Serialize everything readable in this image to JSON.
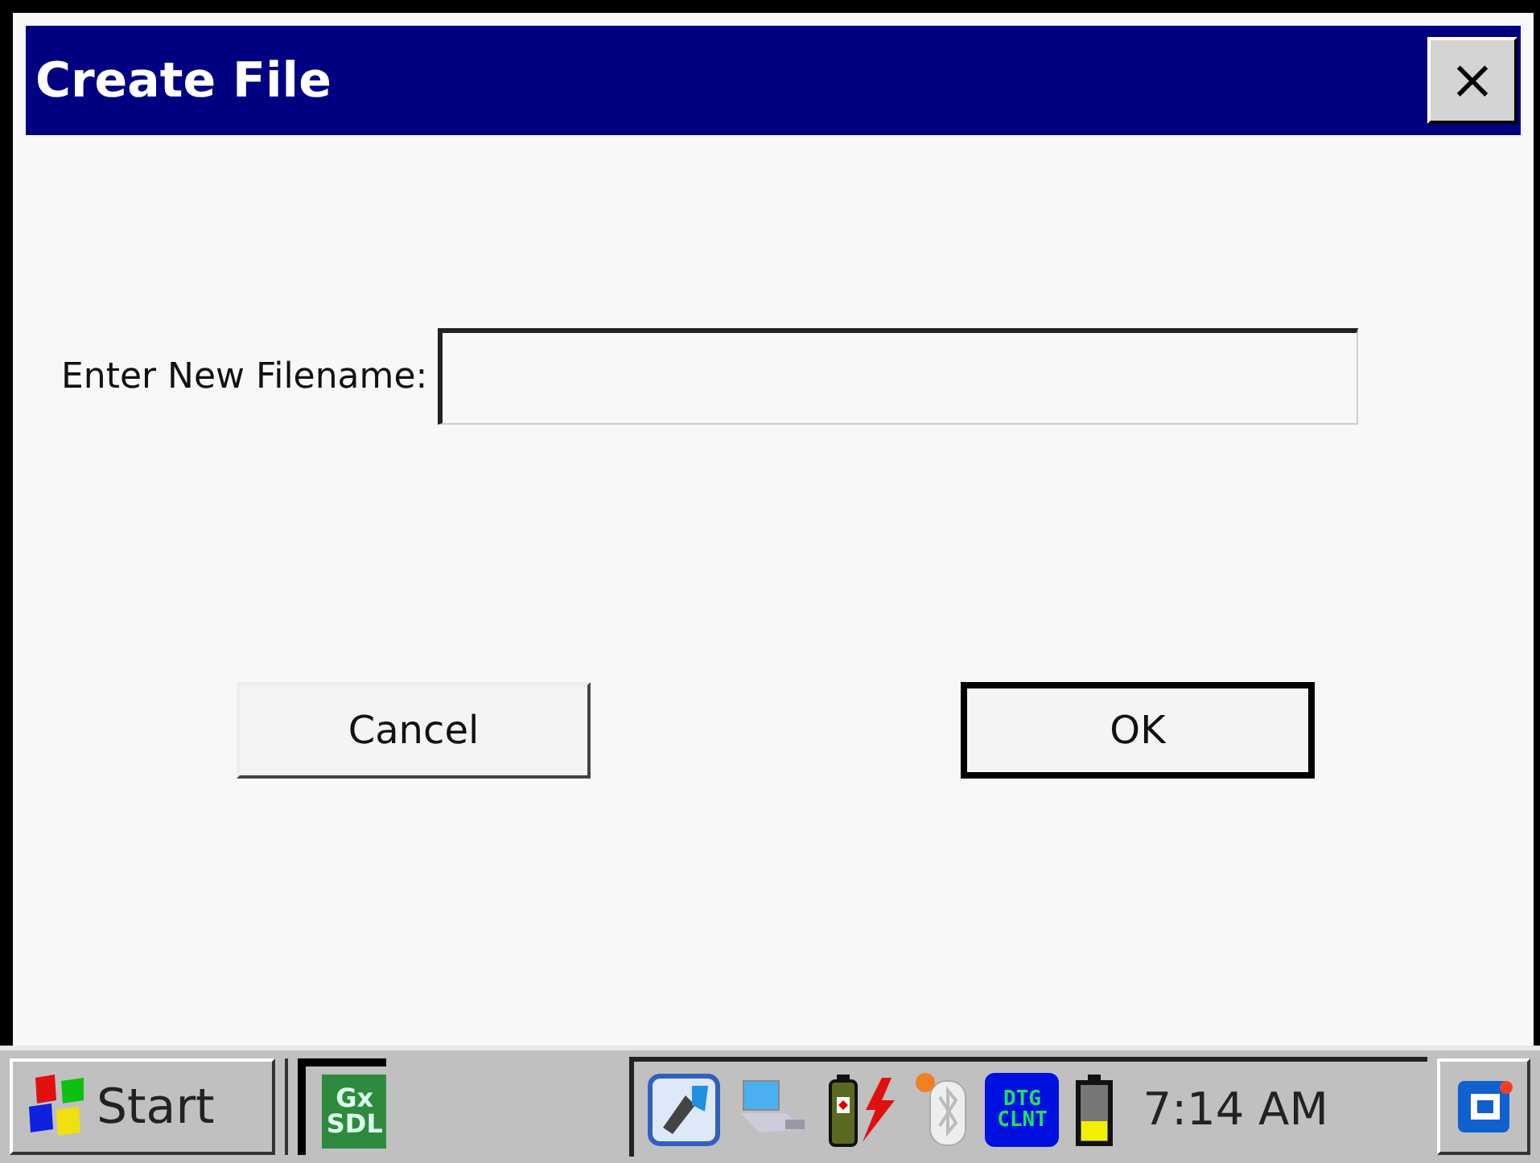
{
  "window": {
    "title": "Create File",
    "close": "×"
  },
  "form": {
    "label": "Enter New Filename:"
  },
  "buttons": [
    {
      "label": "Cancel",
      "default": false
    },
    {
      "label": "OK",
      "default": true
    }
  ],
  "taskbar": {
    "start": "Start",
    "app_icon": {
      "line1": "Gx",
      "line2": "SDL"
    },
    "tray_icon": {
      "line1": "DTG",
      "line2": "CLNT"
    },
    "clock": "7:14 AM"
  }
}
